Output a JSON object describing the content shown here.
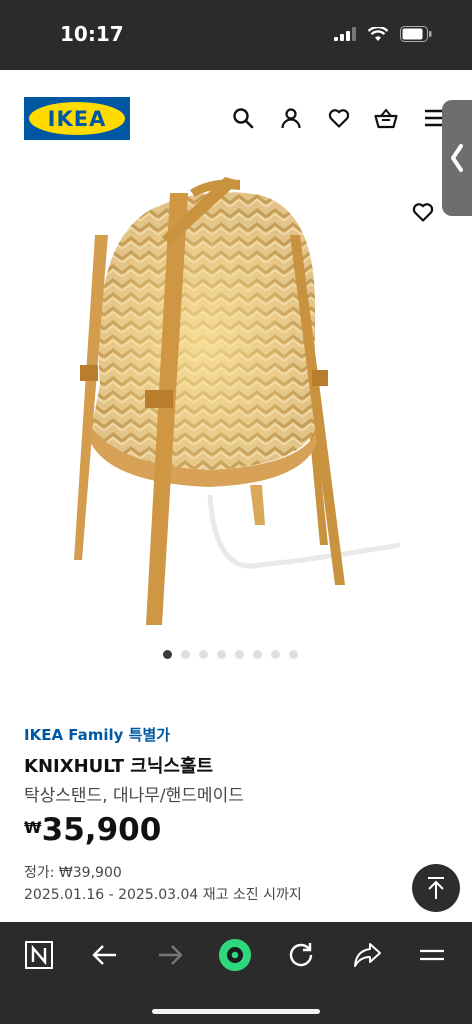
{
  "status_bar": {
    "time": "10:17"
  },
  "header": {
    "brand": "IKEA"
  },
  "product": {
    "family_label": "IKEA Family 특별가",
    "name": "KNIXHULT 크닉스훌트",
    "description": "탁상스탠드, 대나무/핸드메이드",
    "currency": "₩",
    "price": "35,900",
    "regular_price": "정가: ₩39,900",
    "period": "2025.01.16 - 2025.03.04 재고 소진 시까지"
  },
  "carousel": {
    "count": 8,
    "active": 1
  },
  "colors": {
    "ikea_blue": "#0058a3",
    "ikea_yellow": "#ffdb00",
    "browser_accent": "#2ed87c"
  },
  "icons": {
    "header": [
      "search-icon",
      "user-icon",
      "heart-icon",
      "basket-icon",
      "menu-icon"
    ],
    "browser": [
      "naver-n-icon",
      "back-arrow-icon",
      "forward-arrow-icon",
      "green-dot-icon",
      "reload-icon",
      "share-icon",
      "menu-icon"
    ]
  }
}
